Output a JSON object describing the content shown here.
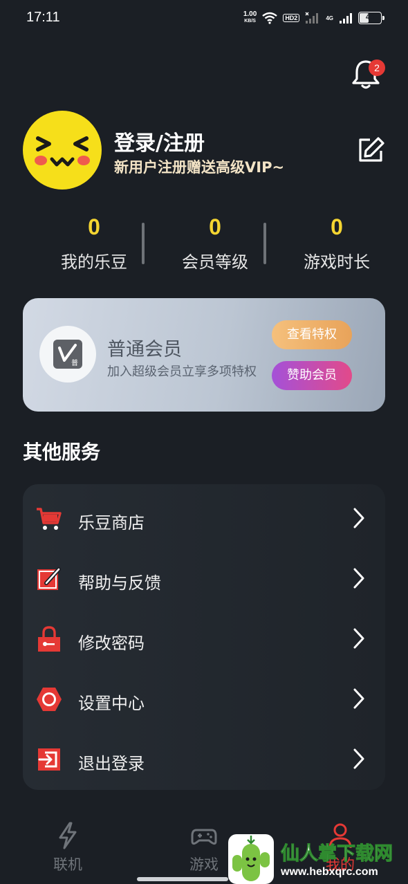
{
  "status_bar": {
    "time": "17:11",
    "net_speed_value": "1.00",
    "net_speed_unit": "KB/S",
    "hd_label": "HD2",
    "network_label": "4G",
    "battery_percent": "45",
    "battery_level": 0.45
  },
  "notifications": {
    "badge_count": "2",
    "icon": "bell-icon"
  },
  "profile": {
    "title": "登录/注册",
    "subtitle": "新用户注册赠送高级VIP~",
    "edit_icon": "edit-icon"
  },
  "stats": [
    {
      "value": "0",
      "label": "我的乐豆"
    },
    {
      "value": "0",
      "label": "会员等级"
    },
    {
      "value": "0",
      "label": "游戏时长"
    }
  ],
  "vip_card": {
    "title": "普通会员",
    "subtitle": "加入超级会员立享多项特权",
    "badge_text": "普",
    "view_button": "查看特权",
    "sponsor_button": "赞助会员"
  },
  "other_services": {
    "title": "其他服务",
    "items": [
      {
        "label": "乐豆商店",
        "icon": "cart-icon"
      },
      {
        "label": "帮助与反馈",
        "icon": "feedback-edit-icon"
      },
      {
        "label": "修改密码",
        "icon": "lock-icon"
      },
      {
        "label": "设置中心",
        "icon": "settings-icon"
      },
      {
        "label": "退出登录",
        "icon": "logout-icon"
      }
    ]
  },
  "bottom_nav": [
    {
      "label": "联机",
      "icon": "lightning-icon"
    },
    {
      "label": "游戏",
      "icon": "gamepad-icon"
    },
    {
      "label": "我的",
      "icon": "user-icon"
    }
  ],
  "watermark": {
    "text": "仙人掌下载网",
    "url": "www.hebxqrc.com"
  },
  "colors": {
    "background": "#1b1f25",
    "accent_yellow": "#f5d531",
    "accent_red": "#e53935",
    "vip_view_button": "#f0b26e",
    "vip_sponsor_button": "#c04ec0"
  }
}
